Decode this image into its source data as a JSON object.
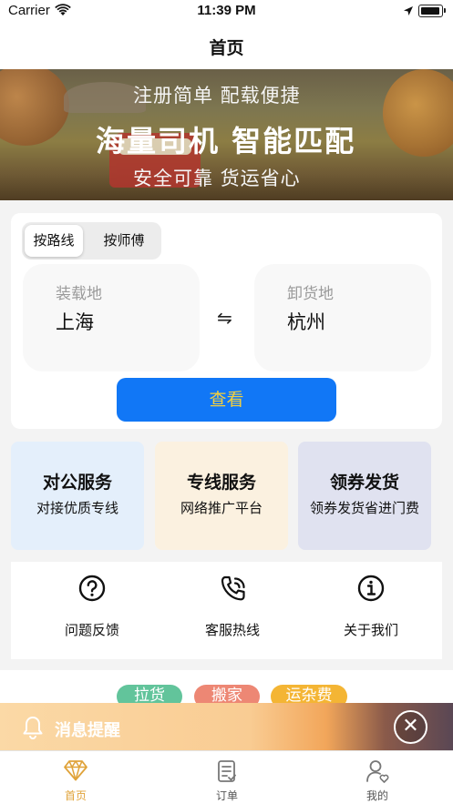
{
  "status_bar": {
    "carrier": "Carrier",
    "time": "11:39 PM"
  },
  "nav": {
    "title": "首页"
  },
  "banner": {
    "line1": "注册简单 配载便捷",
    "line2": "海量司机 智能匹配",
    "line3": "安全可靠 货运省心"
  },
  "route": {
    "segments": [
      "按路线",
      "按师傅"
    ],
    "selected_segment": "按路线",
    "from_label": "装载地",
    "from_value": "上海",
    "swap_symbol": "⇋",
    "to_label": "卸货地",
    "to_value": "杭州",
    "view_button": "查看"
  },
  "services": [
    {
      "title": "对公服务",
      "subtitle": "对接优质专线"
    },
    {
      "title": "专线服务",
      "subtitle": "网络推广平台"
    },
    {
      "title": "领券发货",
      "subtitle": "领券发货省进门费"
    }
  ],
  "tools": [
    {
      "label": "问题反馈",
      "icon": "question-circle-icon"
    },
    {
      "label": "客服热线",
      "icon": "phone-ringing-icon"
    },
    {
      "label": "关于我们",
      "icon": "info-circle-icon"
    }
  ],
  "tags": [
    "拉货",
    "搬家",
    "运杂费"
  ],
  "notice": {
    "text": "消息提醒",
    "close_symbol": "✕"
  },
  "tabbar": {
    "items": [
      {
        "label": "首页",
        "icon": "diamond-icon",
        "active": true
      },
      {
        "label": "订单",
        "icon": "order-list-icon",
        "active": false
      },
      {
        "label": "我的",
        "icon": "user-heart-icon",
        "active": false
      }
    ]
  },
  "colors": {
    "accent": "#1177f6",
    "button_text": "#f4d03f",
    "tab_active": "#e0a33a"
  }
}
